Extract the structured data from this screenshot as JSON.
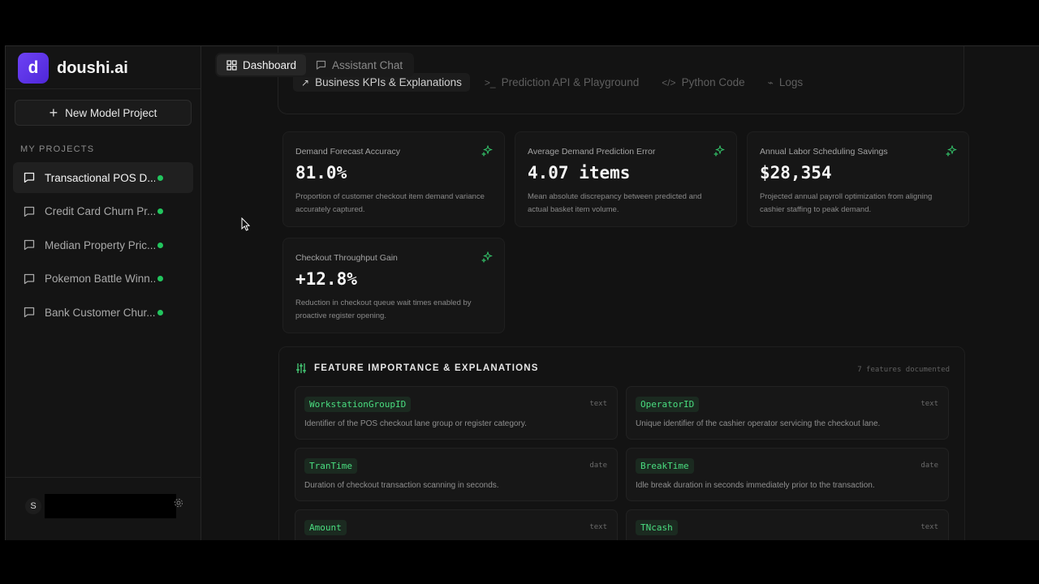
{
  "brand": {
    "logo_letter": "d",
    "name": "doushi.ai"
  },
  "sidebar": {
    "new_project_label": "New Model Project",
    "section_label": "MY PROJECTS",
    "projects": [
      {
        "name": "Transactional POS D...",
        "active": true
      },
      {
        "name": "Credit Card Churn Pr...",
        "active": false
      },
      {
        "name": "Median Property Pric...",
        "active": false
      },
      {
        "name": "Pokemon Battle Winn...",
        "active": false
      },
      {
        "name": "Bank Customer Chur...",
        "active": false
      }
    ],
    "user_initial": "S"
  },
  "topbar": {
    "tabs": [
      {
        "label": "Dashboard",
        "active": true
      },
      {
        "label": "Assistant Chat",
        "active": false
      }
    ]
  },
  "subtabs": [
    {
      "label": "Business KPIs & Explanations",
      "icon": "trend-icon",
      "active": true
    },
    {
      "label": "Prediction API & Playground",
      "icon": "terminal-icon",
      "active": false
    },
    {
      "label": "Python Code",
      "icon": "code-icon",
      "active": false
    },
    {
      "label": "Logs",
      "icon": "activity-icon",
      "active": false
    }
  ],
  "kpis": [
    {
      "label": "Demand Forecast Accuracy",
      "value": "81.0%",
      "desc": "Proportion of customer checkout item demand variance accurately captured."
    },
    {
      "label": "Average Demand Prediction Error",
      "value": "4.07 items",
      "desc": "Mean absolute discrepancy between predicted and actual basket item volume."
    },
    {
      "label": "Annual Labor Scheduling Savings",
      "value": "$28,354",
      "desc": "Projected annual payroll optimization from aligning cashier staffing to peak demand."
    },
    {
      "label": "Checkout Throughput Gain",
      "value": "+12.8%",
      "desc": "Reduction in checkout queue wait times enabled by proactive register opening."
    }
  ],
  "feature_importance": {
    "title": "FEATURE IMPORTANCE & EXPLANATIONS",
    "count_text": "7 features documented",
    "features": [
      {
        "name": "WorkstationGroupID",
        "type": "text",
        "desc": "Identifier of the POS checkout lane group or register category."
      },
      {
        "name": "OperatorID",
        "type": "text",
        "desc": "Unique identifier of the cashier operator servicing the checkout lane."
      },
      {
        "name": "TranTime",
        "type": "date",
        "desc": "Duration of checkout transaction scanning in seconds."
      },
      {
        "name": "BreakTime",
        "type": "date",
        "desc": "Idle break duration in seconds immediately prior to the transaction."
      },
      {
        "name": "Amount",
        "type": "text",
        "desc": ""
      },
      {
        "name": "TNcash",
        "type": "text",
        "desc": ""
      }
    ]
  },
  "colors": {
    "accent": "#5b32e8",
    "status_dot": "#22c55e",
    "feature_green": "#4ade80"
  }
}
